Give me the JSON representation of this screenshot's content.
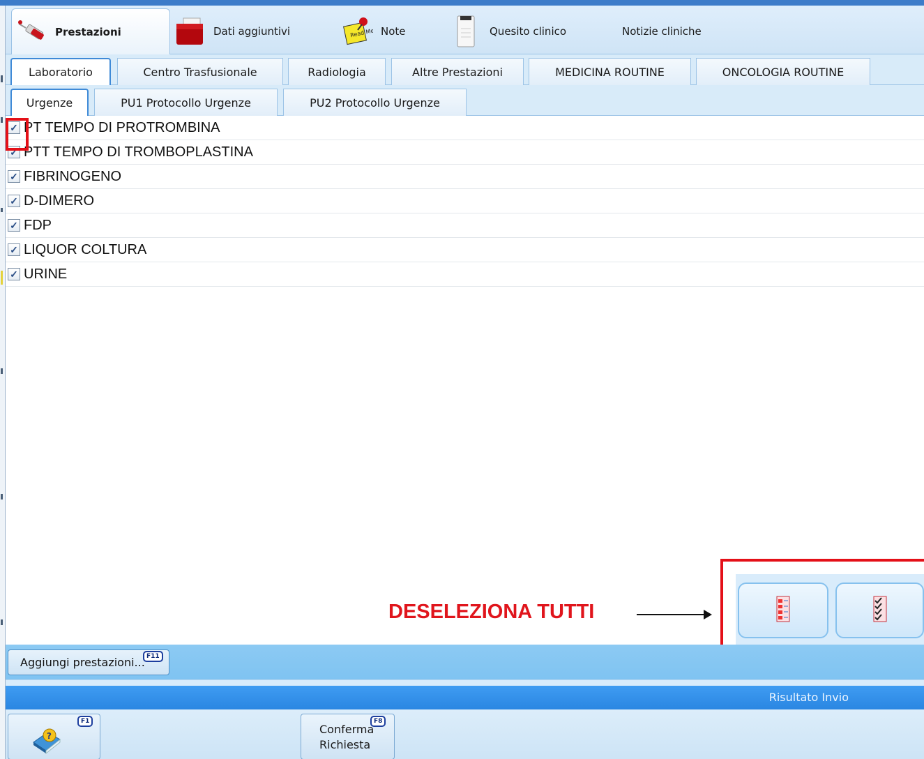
{
  "main_tabs": [
    {
      "label": "Prestazioni",
      "icon": "syringe-icon",
      "active": true
    },
    {
      "label": "Dati aggiuntivi",
      "icon": "folder-icon",
      "active": false
    },
    {
      "label": "Note",
      "icon": "sticky-note-icon",
      "active": false
    },
    {
      "label": "Quesito clinico",
      "icon": "document-icon",
      "active": false
    },
    {
      "label": "Notizie cliniche",
      "icon": "",
      "active": false
    }
  ],
  "note_icon_text": "Read Me",
  "category_tabs": [
    {
      "label": "Laboratorio",
      "active": true
    },
    {
      "label": "Centro Trasfusionale",
      "active": false
    },
    {
      "label": "Radiologia",
      "active": false
    },
    {
      "label": "Altre Prestazioni",
      "active": false
    },
    {
      "label": "MEDICINA ROUTINE",
      "active": false
    },
    {
      "label": "ONCOLOGIA ROUTINE",
      "active": false
    }
  ],
  "protocol_tabs": [
    {
      "label": "Urgenze",
      "active": true
    },
    {
      "label": "PU1 Protocollo Urgenze",
      "active": false
    },
    {
      "label": "PU2 Protocollo Urgenze",
      "active": false
    }
  ],
  "exams": [
    {
      "label": "PT TEMPO DI PROTROMBINA",
      "checked": true
    },
    {
      "label": "PTT TEMPO DI TROMBOPLASTINA",
      "checked": true
    },
    {
      "label": "FIBRINOGENO",
      "checked": true
    },
    {
      "label": "D-DIMERO",
      "checked": true
    },
    {
      "label": "FDP",
      "checked": true
    },
    {
      "label": "LIQUOR COLTURA",
      "checked": true
    },
    {
      "label": "URINE",
      "checked": true
    }
  ],
  "checkmark": "✓",
  "annotation": {
    "text": "DESELEZIONA TUTTI",
    "color": "#e0151c"
  },
  "select_buttons": [
    {
      "icon": "deselect-all-list-icon"
    },
    {
      "icon": "select-all-checklist-icon"
    }
  ],
  "add_button": {
    "label": "Aggiungi prestazioni...",
    "shortcut": "F11"
  },
  "status": {
    "text": "Risultato Invio"
  },
  "help_button": {
    "shortcut": "F1",
    "icon": "help-book-icon"
  },
  "confirm_button": {
    "label_line1": "Conferma",
    "label_line2": "Richiesta",
    "shortcut": "F8"
  },
  "colors": {
    "accent": "#3f8ad7",
    "highlight": "#e41018",
    "status_bar": "#2a86e2",
    "tab_bg": "#d8ebf9"
  }
}
